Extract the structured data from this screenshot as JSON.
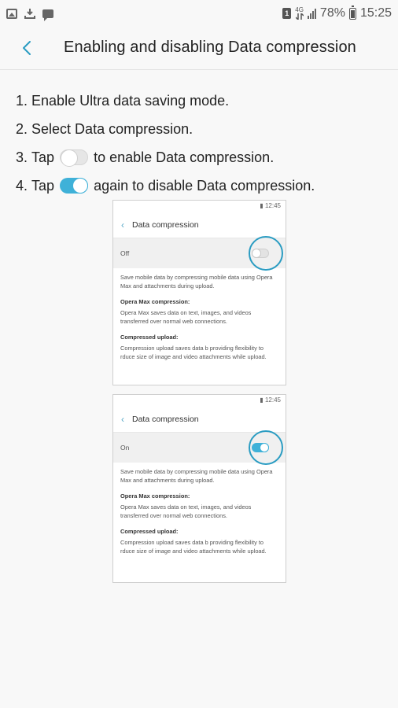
{
  "status_bar": {
    "battery_percent": "78%",
    "time": "15:25",
    "network_label": "4G",
    "icons_left": [
      "image-icon",
      "download-icon",
      "message-icon"
    ],
    "icons_right": [
      "sim-icon",
      "network-icon",
      "signal-icon",
      "battery-icon"
    ]
  },
  "header": {
    "title": "Enabling and disabling Data compression",
    "accent_color": "#2a9cc2"
  },
  "steps": [
    {
      "number": "1.",
      "text": "Enable Ultra data saving mode."
    },
    {
      "number": "2.",
      "text": "Select Data compression."
    },
    {
      "number": "3.",
      "prefix": "Tap",
      "text": "to enable Data compression.",
      "toggle": "off"
    },
    {
      "number": "4.",
      "prefix": "Tap",
      "text": "again to disable Data compression.",
      "toggle": "on"
    }
  ],
  "mock_screens": [
    {
      "time": "12:45",
      "title": "Data compression",
      "state_label": "Off",
      "toggle": "off",
      "description": "Save mobile data by compressing mobile data using Opera Max and attachments during upload.",
      "section1_title": "Opera Max compression:",
      "section1_text": "Opera Max saves data on text, images, and videos transferred over normal web connections.",
      "section2_title": "Compressed upload:",
      "section2_text": "Compression upload saves data b providing flexibility to rduce size of image and video attachments while upload."
    },
    {
      "time": "12:45",
      "title": "Data compression",
      "state_label": "On",
      "toggle": "on",
      "description": "Save mobile data by compressing mobile data using Opera Max and attachments during upload.",
      "section1_title": "Opera Max compression:",
      "section1_text": "Opera Max saves data on text, images, and videos transferred over normal web connections.",
      "section2_title": "Compressed upload:",
      "section2_text": "Compression upload saves data b providing flexibility to rduce size of image and video attachments while upload."
    }
  ]
}
